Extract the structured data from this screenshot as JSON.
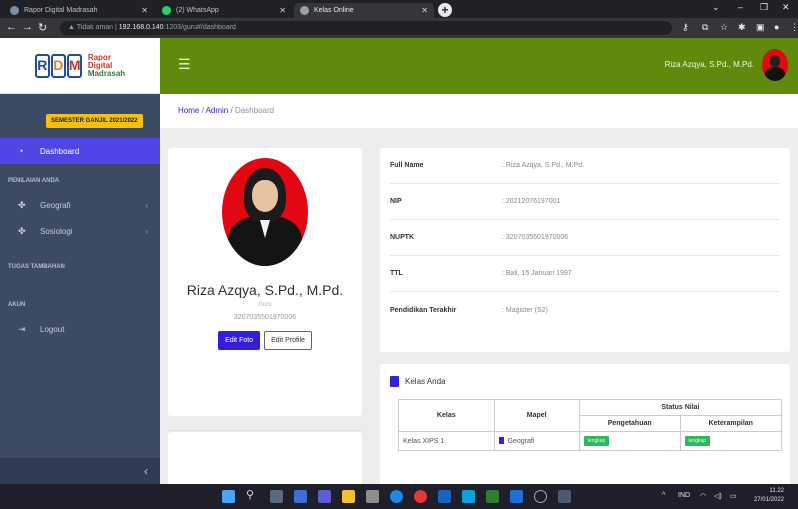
{
  "browser": {
    "tabs": [
      {
        "title": "Rapor Digital Madrasah",
        "favicon_color": "#7b8fa8"
      },
      {
        "title": "(2) WhatsApp",
        "favicon_color": "#25d366"
      },
      {
        "title": "Kelas Online",
        "favicon_color": "#9aa0a6"
      }
    ],
    "security_label": "Tidak aman",
    "url_host": "192.168.0.140",
    "url_path": ":1203/guru#/dashboard"
  },
  "header": {
    "logo_letters": [
      "R",
      "D",
      "M"
    ],
    "logo_line1": "Rapor",
    "logo_line2": "Digital",
    "logo_line3": "Madrasah",
    "user_name": "Riza Azqya, S.Pd., M.Pd.",
    "topbar_color": "#5f8a0c"
  },
  "sidebar": {
    "semester": "SEMESTER GANJIL 2021/2022",
    "dashboard": "Dashboard",
    "section_penilaian": "PENILAIAN ANDA",
    "item_geografi": "Geografi",
    "item_sosiologi": "Sosiologi",
    "section_tugas": "TUGAS TAMBAHAN",
    "section_akun": "AKUN",
    "item_logout": "Logout",
    "collapse_glyph": "‹"
  },
  "breadcrumb": {
    "home": "Home",
    "admin": "Admin",
    "current": "Dashboard"
  },
  "profile": {
    "name": "Riza Azqya, S.Pd., M.Pd.",
    "role": "Guru",
    "nip": "3207035501970006",
    "edit_foto": "Edit Foto",
    "edit_profile": "Edit Profile"
  },
  "info": {
    "rows": [
      {
        "label": "Full Name",
        "value": ": Riza Azqya, S.Pd., M.Pd."
      },
      {
        "label": "NIP",
        "value": ": 20212076197001"
      },
      {
        "label": "NUPTK",
        "value": ": 3207035501970006"
      },
      {
        "label": "TTL",
        "value": ": Bali, 15 Januari 1997"
      },
      {
        "label": "Pendidikan Terakhir",
        "value": ": Magister (S2)"
      }
    ]
  },
  "kelas": {
    "title": "Kelas Anda",
    "col_kelas": "Kelas",
    "col_mapel": "Mapel",
    "col_status": "Status Nilai",
    "col_pengetahuan": "Pengetahuan",
    "col_keterampilan": "Keterampilan",
    "rows": [
      {
        "kelas": "Kelas XIPS 1",
        "mapel": "Geografi",
        "pengetahuan": "lengkap",
        "keterampilan": "lengkap"
      }
    ]
  },
  "taskbar": {
    "lang": "IND",
    "time": "11.22",
    "date": "27/01/2022"
  }
}
